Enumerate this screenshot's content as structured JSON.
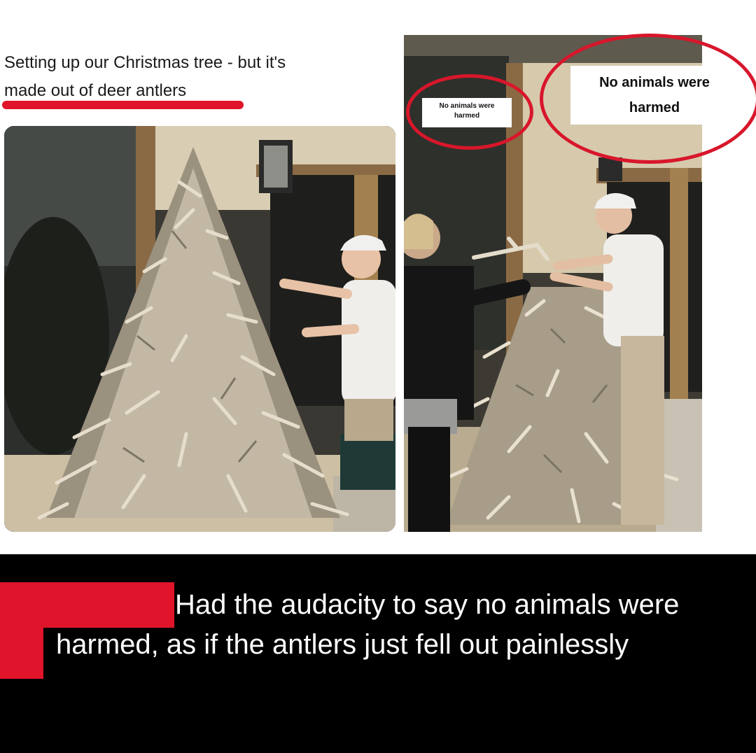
{
  "tweet": {
    "caption_line1": "Setting up our Christmas tree - but it's",
    "caption_line2": "made out of deer antlers"
  },
  "overlays": {
    "small_label_line1": "No animals were",
    "small_label_line2": "harmed",
    "big_label_line1": "No animals were",
    "big_label_line2": "harmed"
  },
  "reply": {
    "text": "Had the audacity to say no animals were harmed, as if the antlers just fell out painlessly"
  },
  "colors": {
    "highlight_red": "#e0142a",
    "caption_bg": "#000000",
    "caption_text": "#ffffff"
  }
}
